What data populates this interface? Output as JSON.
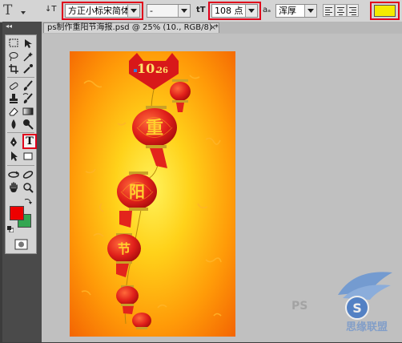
{
  "options_bar": {
    "tool_glyph": "T",
    "orient_glyph": "↓T",
    "font_family": "方正小标宋简体",
    "font_style": "-",
    "size_glyph": "tT",
    "font_size": "108 点",
    "aa_glyph": "aₐ",
    "anti_alias": "浑厚",
    "text_color": "#f5eb00"
  },
  "document_tab": {
    "title": "ps制作重阳节海报.psd @ 25% (10., RGB/8) *",
    "close_label": "×"
  },
  "toolbox": {
    "collapse_glyph": "◂◂",
    "type_tool_label": "T",
    "foreground_color": "#ee0000",
    "background_color": "#33a651"
  },
  "poster": {
    "date_main": "10.",
    "date_small": "26",
    "lantern_chars": [
      "重",
      "阳",
      "节"
    ]
  }
}
